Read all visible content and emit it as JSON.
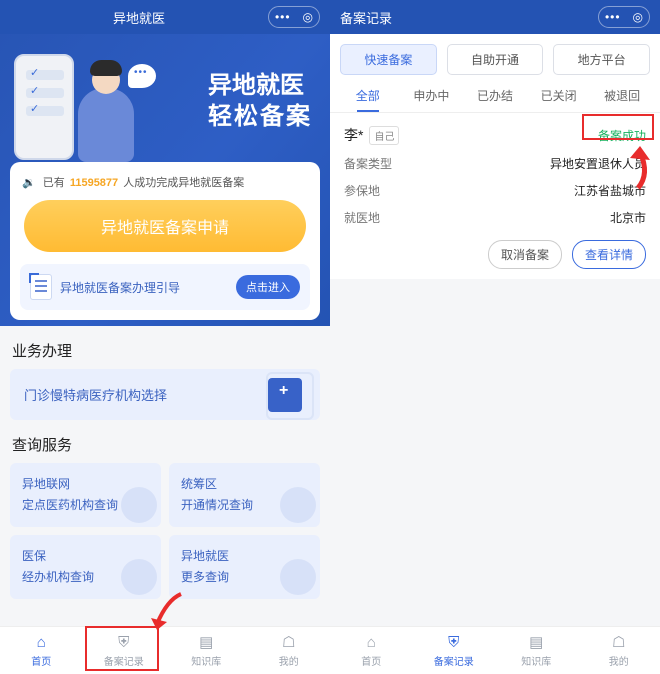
{
  "left": {
    "header": {
      "title": "异地就医"
    },
    "banner": {
      "line1": "异地就医",
      "line2": "轻松备案"
    },
    "count_prefix": "已有",
    "count_number": "11595877",
    "count_suffix": "人成功完成异地就医备案",
    "apply_button": "异地就医备案申请",
    "guide_text": "异地就医备案办理引导",
    "guide_btn": "点击进入",
    "section1": "业务办理",
    "wide_item": "门诊慢特病医疗机构选择",
    "section2": "查询服务",
    "tiles": [
      {
        "l1": "异地联网",
        "l2": "定点医药机构查询"
      },
      {
        "l1": "统筹区",
        "l2": "开通情况查询"
      },
      {
        "l1": "医保",
        "l2": "经办机构查询"
      },
      {
        "l1": "异地就医",
        "l2": "更多查询"
      }
    ],
    "tabs": [
      "首页",
      "备案记录",
      "知识库",
      "我的"
    ]
  },
  "right": {
    "header": {
      "title": "备案记录"
    },
    "chips": [
      "快速备案",
      "自助开通",
      "地方平台"
    ],
    "status_tabs": [
      "全部",
      "申办中",
      "已办结",
      "已关闭",
      "被退回"
    ],
    "record": {
      "name": "李*",
      "self_badge": "自己",
      "status": "备案成功",
      "rows": [
        {
          "k": "备案类型",
          "v": "异地安置退休人员"
        },
        {
          "k": "参保地",
          "v": "江苏省盐城市"
        },
        {
          "k": "就医地",
          "v": "北京市"
        }
      ],
      "cancel": "取消备案",
      "detail": "查看详情"
    },
    "tabs": [
      "首页",
      "备案记录",
      "知识库",
      "我的"
    ]
  }
}
